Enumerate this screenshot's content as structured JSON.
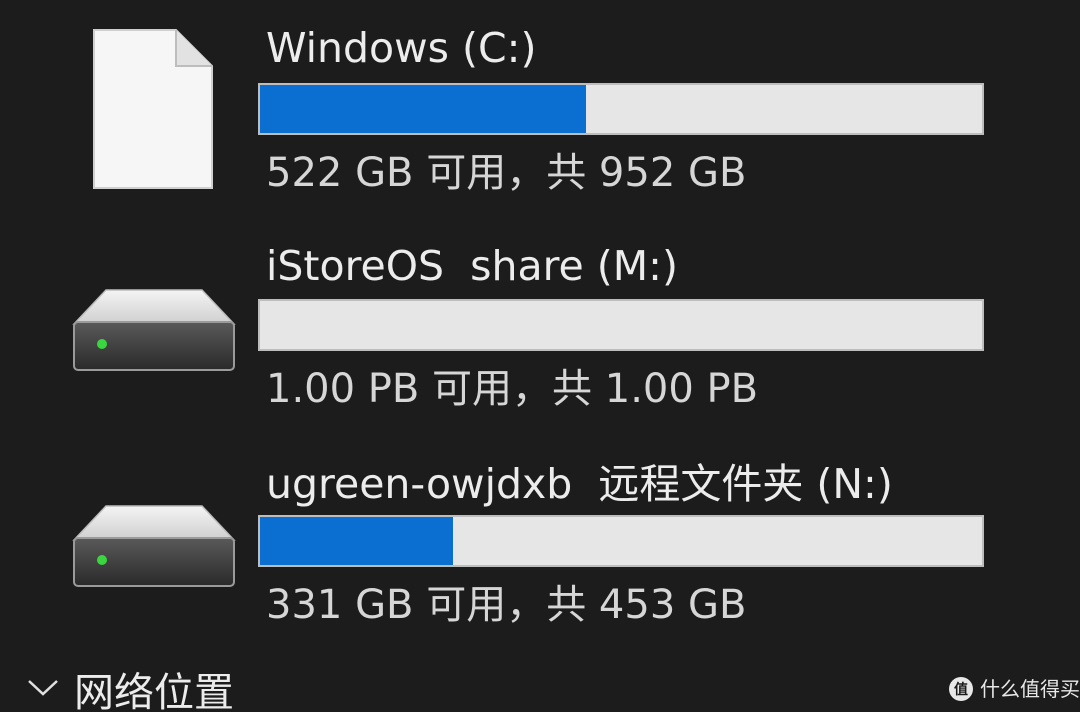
{
  "drives": [
    {
      "title": "Windows (C:)",
      "space_text": "522 GB 可用，共 952 GB",
      "used_fraction": 0.452,
      "icon": "file-icon"
    },
    {
      "title": "iStoreOS  share (M:)",
      "space_text": "1.00 PB 可用，共 1.00 PB",
      "used_fraction": 0.0,
      "icon": "network-drive-icon"
    },
    {
      "title": "ugreen-owjdxb  远程文件夹 (N:)",
      "space_text": "331 GB 可用，共 453 GB",
      "used_fraction": 0.268,
      "icon": "network-drive-icon"
    }
  ],
  "section": {
    "label": "网络位置",
    "icon": "chevron-down-icon"
  },
  "watermark": {
    "text": "什么值得买",
    "icon": "smzdm-logo-icon"
  },
  "colors": {
    "background": "#1c1c1c",
    "bar_fill": "#0a6fd0",
    "bar_track": "#e6e6e6",
    "led_green": "#39d63f"
  }
}
